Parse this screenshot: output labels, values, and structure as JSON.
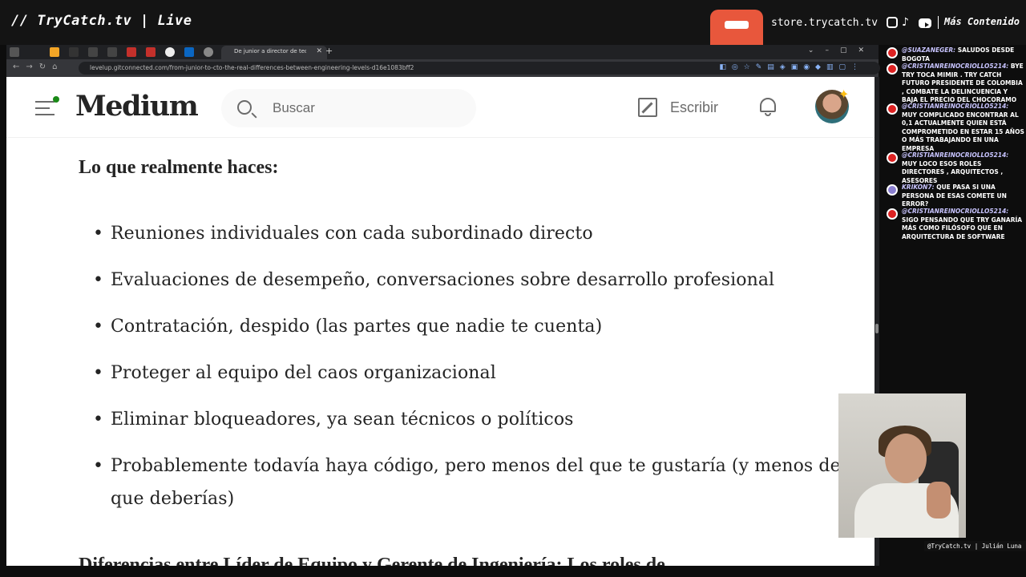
{
  "stream": {
    "title": "// TryCatch.tv | Live",
    "store": "store.trycatch.tv",
    "more": "Más Contenido",
    "lower_third": "@TryCatch.tv | Julián Luna"
  },
  "browser": {
    "active_tab": "De junior a director de tecnología",
    "url": "levelup.gitconnected.com/from-junior-to-cto-the-real-differences-between-engineering-levels-d16e1083bff2"
  },
  "medium": {
    "brand": "Medium",
    "search_placeholder": "Buscar",
    "write_label": "Escribir"
  },
  "article": {
    "section_heading": "Lo que realmente haces:",
    "bullets": [
      "Reuniones individuales con cada subordinado directo",
      "Evaluaciones de desempeño, conversaciones sobre desarrollo profesional",
      "Contratación, despido (las partes que nadie te cuenta)",
      "Proteger al equipo del caos organizacional",
      "Eliminar bloqueadores, ya sean técnicos o políticos",
      "Probablemente todavía haya código, pero menos del que te gustaría (y menos del que deberías)"
    ],
    "next_heading": "Diferencias entre Líder de Equipo y Gerente de Ingeniería: Los roles de"
  },
  "chat": [
    {
      "user": "@SUAZANEGER:",
      "text": "SALUDOS DESDE BOGOTA"
    },
    {
      "user": "@CRISTIANREINOCRIOLLO5214:",
      "text": "BYE TRY TOCA MIMIR . TRY CATCH FUTURO PRESIDENTE DE COLOMBIA , COMBATE LA DELINCUENCIA Y BAJA EL PRECIO DEL CHOCORAMO"
    },
    {
      "user": "@CRISTIANREINOCRIOLLO5214:",
      "text": "MUY COMPLICADO ENCONTRAR AL 0,1 ACTUALMENTE QUIEN ESTÁ COMPROMETIDO EN ESTAR 15 AÑOS O MÁS TRABAJANDO EN UNA EMPRESA"
    },
    {
      "user": "@CRISTIANREINOCRIOLLO5214:",
      "text": "MUY LOCO ESOS ROLES DIRECTORES , ARQUITECTOS , ASESORES"
    },
    {
      "user": "KRIKON7:",
      "text": "QUE PASA SI UNA PERSONA DE ESAS COMETE UN ERROR?"
    },
    {
      "user": "@CRISTIANREINOCRIOLLO5214:",
      "text": "SIGO PENSANDO QUE TRY GANARÍA MÁS COMO FILÓSOFO QUE EN ARQUITECTURA DE SOFTWARE"
    }
  ]
}
